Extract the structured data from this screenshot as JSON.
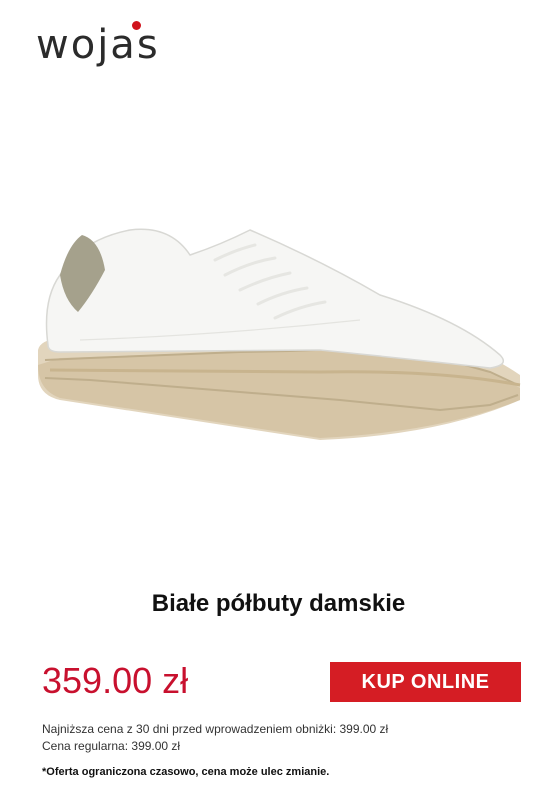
{
  "brand": {
    "logo_text": "wojas",
    "accent_color": "#d0131c"
  },
  "product": {
    "image_icon": "white-sneaker-image",
    "title": "Białe półbuty damskie",
    "price": "359.00 zł",
    "cta_label": "KUP ONLINE",
    "lowest_price_note": "Najniższa cena z 30 dni przed wprowadzeniem obniżki: 399.00 zł",
    "regular_price_note": "Cena regularna: 399.00 zł",
    "disclaimer": "*Oferta ograniczona czasowo, cena może ulec zmianie."
  },
  "colors": {
    "price": "#c8102e",
    "button": "#d51d24"
  }
}
